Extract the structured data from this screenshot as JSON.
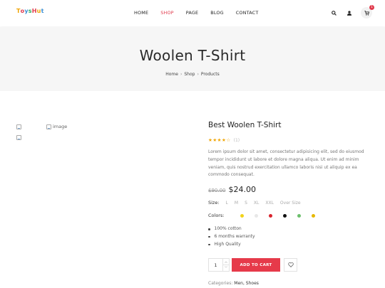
{
  "header": {
    "logo": [
      {
        "ch": "T",
        "color": "#f0a400"
      },
      {
        "ch": "o",
        "color": "#e03a4c"
      },
      {
        "ch": "y",
        "color": "#3b8fd6"
      },
      {
        "ch": "s",
        "color": "#2fae5f"
      },
      {
        "ch": "H",
        "color": "#e03a4c"
      },
      {
        "ch": "u",
        "color": "#f0a400"
      },
      {
        "ch": "t",
        "color": "#3b8fd6"
      }
    ],
    "nav": [
      "HOME",
      "SHOP",
      "PAGE",
      "BLOG",
      "CONTACT"
    ],
    "active_nav": "SHOP",
    "cart_count": "1",
    "icons": [
      "search-icon",
      "user-icon",
      "cart-icon"
    ]
  },
  "banner": {
    "title": "Woolen T-Shirt",
    "breadcrumb": [
      "Home",
      "Shop",
      "Products"
    ]
  },
  "gallery": {
    "main_image_alt": "image"
  },
  "product": {
    "title": "Best Woolen T-Shirt",
    "rating": 4.5,
    "rating_count": "(1)",
    "description": "Lorem ipsum dolor sit amet, consectetur adipisicing elit, sed do eiusmod tempor incididunt ut labore et dolore magna aliqua. Ut enim ad minim veniam, quis nostrud exercitation ullamco laboris nisi ut aliquip ex ea commodo consequat.",
    "old_price": "$90.00",
    "price": "$24.00",
    "size_label": "Size:",
    "sizes": [
      "L",
      "M",
      "S",
      "XL",
      "XXL",
      "Over Size"
    ],
    "colors_label": "Colors:",
    "colors": [
      "#f2d31a",
      "#e8e8e8",
      "#d9232d",
      "#111111",
      "#6cbf6c",
      "#e6b800"
    ],
    "features": [
      "100% cotton",
      "6 months warranty",
      "High Quality"
    ],
    "quantity": "1",
    "add_to_cart": "ADD TO CART",
    "categories_label": "Categories:",
    "categories": "Men, Shoes"
  },
  "accent_color": "#e63a4a"
}
